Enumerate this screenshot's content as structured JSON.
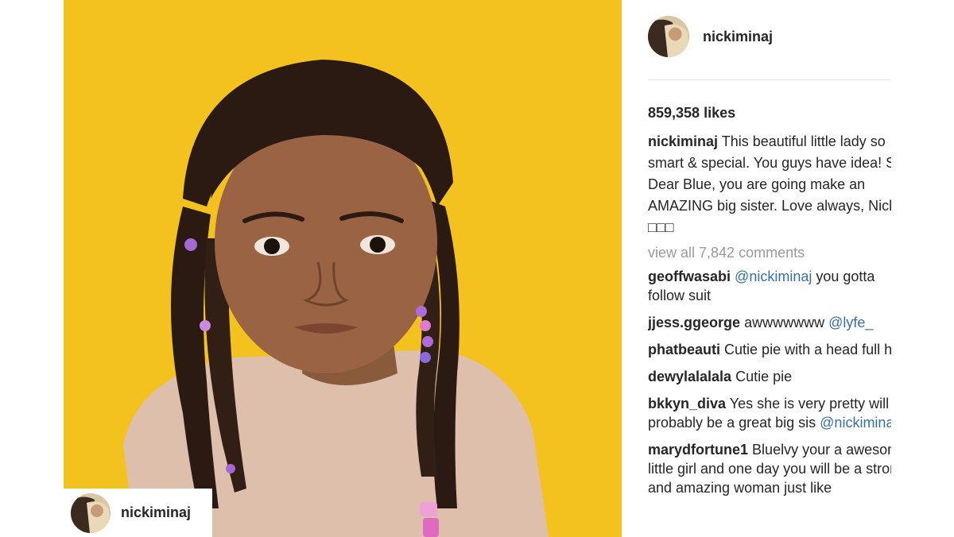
{
  "post": {
    "username": "nickiminaj",
    "likes": "859,358 likes",
    "caption_username": "nickiminaj",
    "caption_text": "This beautiful little lady so smart & special. You guys have idea! So Dear Blue, you are going make an AMAZING big sister. Love always, Nicki □□□",
    "view_all_comments": "view all 7,842 comments"
  },
  "photo_overlay": {
    "username": "nickiminaj"
  },
  "comments": [
    {
      "user": "geoffwasabi",
      "mention": "@nickiminaj",
      "text": " you gotta follow suit"
    },
    {
      "user": "jjess.ggeorge",
      "text": "awwwwwww ",
      "mention": "@lyfe_"
    },
    {
      "user": "phatbeauti",
      "text": "Cutie pie with a head full hair"
    },
    {
      "user": "dewylalalala",
      "text": "Cutie pie"
    },
    {
      "user": "bkkyn_diva",
      "text": "Yes she is very pretty will probably be a great big sis",
      "mention": "@nickiminaj"
    },
    {
      "user": "marydfortune1",
      "text": "Bluelvy your a awesome little girl and one day you will be a strong and amazing woman just like"
    }
  ],
  "colors": {
    "photo_background": "#f4c21e",
    "mention": "#3a6ea5",
    "muted_text": "#999999"
  }
}
